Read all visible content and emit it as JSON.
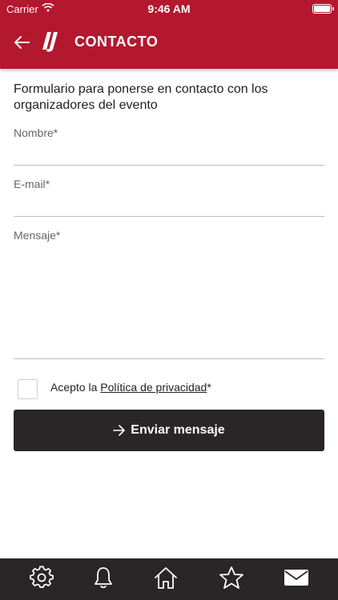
{
  "status_bar": {
    "carrier": "Carrier",
    "time": "9:46 AM"
  },
  "header": {
    "title": "CONTACTO",
    "back_icon": "arrow-left-icon",
    "logo": "brand-logo"
  },
  "form": {
    "intro": "Formulario para ponerse en contacto con los organizadores del evento",
    "fields": [
      {
        "label": "Nombre*",
        "value": ""
      },
      {
        "label": "E-mail*",
        "value": ""
      },
      {
        "label": "Mensaje*",
        "value": ""
      }
    ],
    "consent": {
      "prefix": "Acepto la ",
      "link": "Política de privacidad",
      "suffix": "*",
      "checked": false
    },
    "submit_label": "Enviar mensaje"
  },
  "tabbar": {
    "items": [
      {
        "icon": "gear-icon"
      },
      {
        "icon": "bell-icon"
      },
      {
        "icon": "home-icon"
      },
      {
        "icon": "star-icon"
      },
      {
        "icon": "envelope-icon",
        "active": true
      }
    ]
  },
  "colors": {
    "accent": "#b3182e",
    "dark": "#2a2526"
  }
}
